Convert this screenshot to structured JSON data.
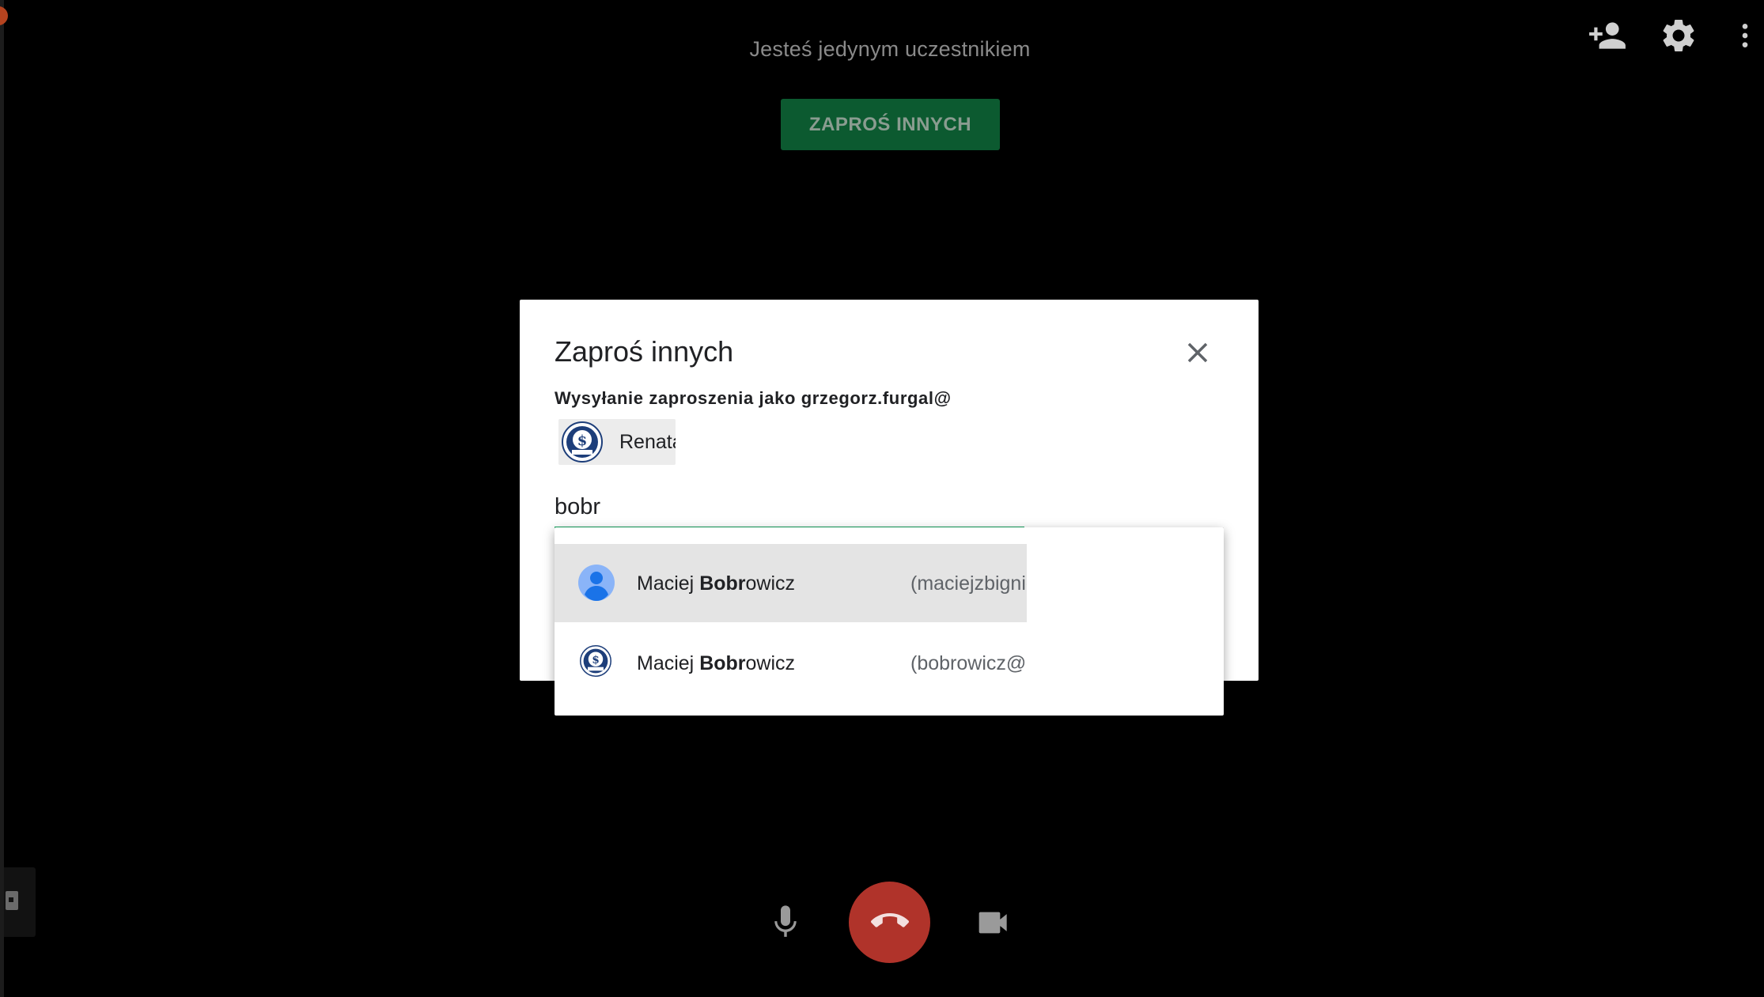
{
  "meeting": {
    "status_text": "Jesteś jedynym uczestnikiem",
    "invite_button_label": "ZAPROŚ INNYCH"
  },
  "top_bar": {
    "icons": [
      "add-person-icon",
      "gear-icon",
      "more-vert-icon"
    ]
  },
  "dialog": {
    "title": "Zaproś innych",
    "close_icon": "close-icon",
    "sending_as": "Wysyłanie zaproszenia jako grzegorz.furgal@",
    "chips": [
      {
        "label": "Renata",
        "avatar": "organization-logo"
      }
    ],
    "search": {
      "value": "bobr",
      "placeholder": ""
    },
    "suggestions": [
      {
        "name_prefix": "Maciej ",
        "name_match": "Bobr",
        "name_suffix": "owicz",
        "email": "(maciejzbigniew",
        "avatar": "person-icon",
        "highlighted": true
      },
      {
        "name_prefix": "Maciej ",
        "name_match": "Bobr",
        "name_suffix": "owicz",
        "email": "(bobrowicz@",
        "avatar": "organization-logo",
        "highlighted": false
      }
    ]
  },
  "controls": {
    "icons": [
      "microphone-icon",
      "end-call-icon",
      "camera-icon"
    ],
    "end_call_color": "#b0332a"
  },
  "colors": {
    "accent_green": "#0f9d58",
    "invite_button_bg": "#0c5a30",
    "background": "#000000"
  }
}
